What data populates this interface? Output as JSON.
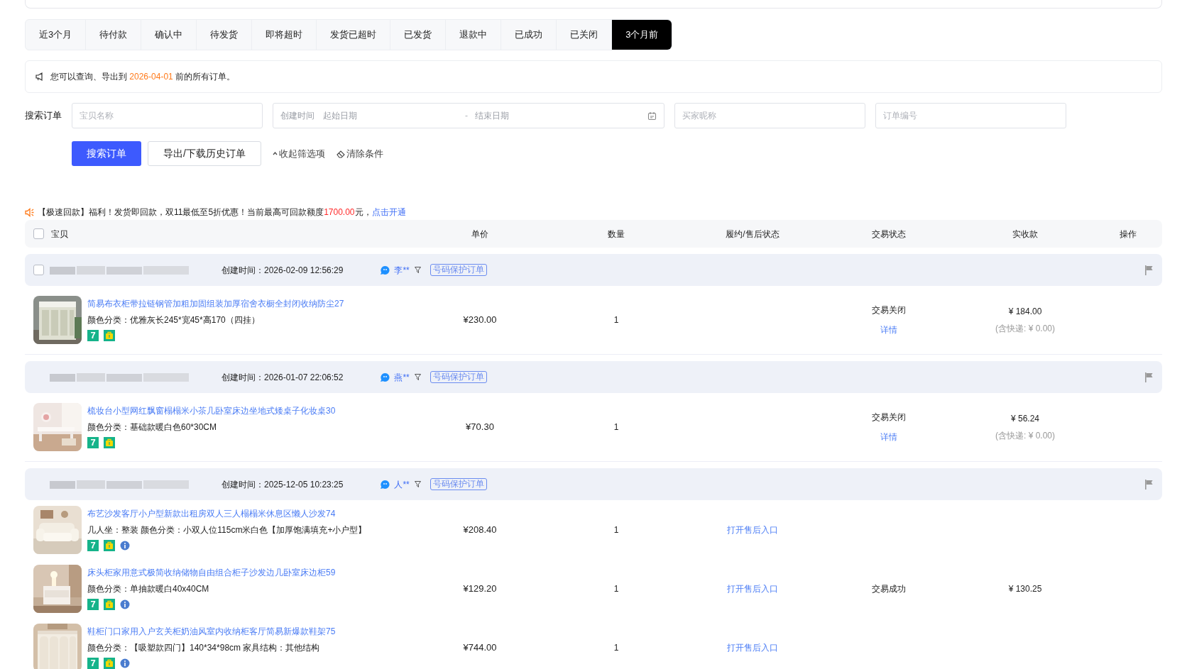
{
  "tabs": [
    {
      "label": "近3个月",
      "selected": false
    },
    {
      "label": "待付款",
      "selected": false
    },
    {
      "label": "确认中",
      "selected": false
    },
    {
      "label": "待发货",
      "selected": false
    },
    {
      "label": "即将超时",
      "selected": false
    },
    {
      "label": "发货已超时",
      "selected": false
    },
    {
      "label": "已发货",
      "selected": false
    },
    {
      "label": "退款中",
      "selected": false
    },
    {
      "label": "已成功",
      "selected": false
    },
    {
      "label": "已关闭",
      "selected": false
    },
    {
      "label": "3个月前",
      "selected": true
    }
  ],
  "notice": {
    "before": "您可以查询、导出到 ",
    "date": "2026-04-01",
    "after": " 前的所有订单。"
  },
  "search": {
    "label": "搜索订单",
    "fields": [
      {
        "kind": "text",
        "placeholder": "宝贝名称"
      },
      {
        "kind": "date_range",
        "label": "创建时间",
        "start_placeholder": "起始日期",
        "separator": "-",
        "end_placeholder": "结束日期"
      },
      {
        "kind": "text",
        "placeholder": "买家昵称"
      },
      {
        "kind": "text",
        "placeholder": "订单编号"
      }
    ],
    "primary_button": "搜索订单",
    "secondary_button": "导出/下载历史订单",
    "collapse_link": "收起筛选项",
    "clear_link": "清除条件"
  },
  "promo": {
    "text": "【极速回款】福利！发货即回款，双11最低至5折优惠！当前最高可回款额度",
    "amount": "1700.00",
    "suffix": "元，",
    "link": "点击开通"
  },
  "table": {
    "select_all_checked": false,
    "columns": [
      "宝贝",
      "单价",
      "数量",
      "履约/售后状态",
      "交易状态",
      "实收款",
      "操作"
    ]
  },
  "orders": [
    {
      "checked": false,
      "created": "创建时间：2026-02-09 12:56:29",
      "buyer": "李**",
      "badge": "号码保护订单",
      "status": "交易关闭",
      "detail_link": "详情",
      "amount": "¥ 184.00",
      "shipping": "(含快递: ¥ 0.00)",
      "items": [
        {
          "kind": "picture",
          "title": "简易布衣柜带拉链钢管加粗加固组装加厚宿舍衣橱全封闭收纳防尘27",
          "spec": "颜色分类：优雅灰长245*宽45*高170（四挂）",
          "price": "¥230.00",
          "quantity": "1",
          "tags": [
            {
              "kind": "seven",
              "text": "7"
            },
            {
              "kind": "bag"
            }
          ]
        }
      ]
    },
    {
      "created": "创建时间：2026-01-07 22:06:52",
      "buyer": "燕**",
      "badge": "号码保护订单",
      "status": "交易关闭",
      "detail_link": "详情",
      "amount": "¥ 56.24",
      "shipping": "(含快递: ¥ 0.00)",
      "items": [
        {
          "kind": "picture",
          "title": "梳妆台小型网红飘窗榻榻米小茶几卧室床边坐地式矮桌子化妆桌30",
          "spec": "颜色分类：基础款暖白色60*30CM",
          "price": "¥70.30",
          "quantity": "1",
          "tags": [
            {
              "kind": "seven",
              "text": "7"
            },
            {
              "kind": "bag"
            }
          ]
        }
      ]
    },
    {
      "created": "创建时间：2025-12-05 10:23:25",
      "buyer": "人**",
      "badge": "号码保护订单",
      "status": "交易成功",
      "amount": "¥ 130.25",
      "items": [
        {
          "kind": "picture",
          "title": "布艺沙发客厅小户型新款出租房双人三人榻榻米休息区懒人沙发74",
          "spec": "几人坐：整装  颜色分类：小双人位115cm米白色【加厚饱满填充+小户型】",
          "price": "¥208.40",
          "quantity": "1",
          "aftersale_link": "打开售后入口",
          "tags": [
            {
              "kind": "seven",
              "text": "7"
            },
            {
              "kind": "bag"
            },
            {
              "kind": "info"
            }
          ]
        },
        {
          "kind": "picture",
          "title": "床头柜家用意式极简收纳储物自由组合柜子沙发边几卧室床边柜59",
          "spec": "颜色分类：单抽款暖白40x40CM",
          "price": "¥129.20",
          "quantity": "1",
          "aftersale_link": "打开售后入口",
          "tags": [
            {
              "kind": "seven",
              "text": "7"
            },
            {
              "kind": "bag"
            },
            {
              "kind": "info"
            }
          ]
        },
        {
          "kind": "picture",
          "title": "鞋柜门口家用入户玄关柜奶油风室内收纳柜客厅简易新爆款鞋架75",
          "spec": "颜色分类：【吸塑款四门】140*34*98cm  家具结构：其他结构",
          "price": "¥744.00",
          "quantity": "1",
          "aftersale_link": "打开售后入口",
          "tags": [
            {
              "kind": "seven",
              "text": "7"
            },
            {
              "kind": "bag"
            },
            {
              "kind": "info"
            }
          ]
        }
      ]
    }
  ]
}
